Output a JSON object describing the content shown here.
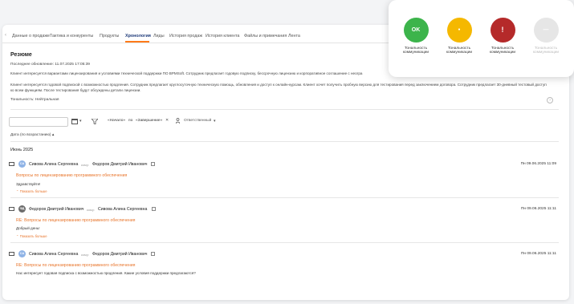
{
  "tabs": [
    "Данные о продаже",
    "Тактика и конкуренты",
    "Продукты",
    "Хронология",
    "Лиды",
    "История продаж",
    "История клиента",
    "Файлы и примечания",
    "Лента"
  ],
  "active_tab": "Хронология",
  "summary": {
    "title": "Резюме",
    "updated": "Последнее обновление: 11.07.2025 17:05:39",
    "para1": "Клиент интересуется вариантами лицензирования и условиями технической поддержки ПО BPMSoft. Сотрудник предлагает годовую подписку, бессрочную лицензию и корпоративное соглашение с неогра",
    "para2": "Клиент интересуется годовой подпиской с возможностью продления. Сотрудник предлагает круглосуточную техническую помощь, обновления и доступ к онлайн-курсам. Клиент хочет получить пробную версию для тестирования перед заключением договора. Сотрудник предлагает 30-дневный тестовый доступ ко всем функциям. После тестирования будут обсуждены детали лицензии.",
    "tone": "Тональность: Нейтральная"
  },
  "filters": {
    "start": "«Начало»",
    "by": "по",
    "end": "«Завершение»",
    "clear": "✕",
    "owner": "Ответственный"
  },
  "sort_label": "Дата (по возрастанию)",
  "sort_arrow": "▴",
  "month": "Июнь 2025",
  "entries": [
    {
      "initials": "СА",
      "from": "Сивова Алина Сергеевна",
      "to_label": "кому:",
      "to": "Федоров Дмитрий Иванович",
      "date": "Пн 09.06.2025 11:09",
      "subject": "Вопросы по лицензированию программного обеспечения",
      "body": "Здравствуйте!",
      "more": "Показать больше"
    },
    {
      "initials": "ФД",
      "from": "Федоров Дмитрий Иванович",
      "to_label": "кому:",
      "to": "Сивова Алина Сергеевна",
      "date": "Пн 09.06.2025 11:11",
      "subject": "RE: Вопросы по лицензированию программного обеспечения",
      "body": "Добрый день!",
      "more": "Показать больше"
    },
    {
      "initials": "СА",
      "from": "Сивова Алина Сергеевна",
      "to_label": "кому:",
      "to": "Федоров Дмитрий Иванович",
      "date": "Пн 09.06.2025 11:11",
      "subject": "RE: Вопросы по лицензированию программного обеспечения",
      "body": "Нас интересует годовая подписка с возможностью продления. Какие условия поддержки предлагаются?",
      "more": ""
    }
  ],
  "tonality": [
    {
      "symbol": "OK",
      "label": "Тональность коммуникации",
      "color": "#3cb44b",
      "disabled": false
    },
    {
      "symbol": "●",
      "label": "Тональность коммуникации",
      "color": "#f5b800",
      "disabled": false
    },
    {
      "symbol": "!",
      "label": "Тональность коммуникации",
      "color": "#b52a2a",
      "disabled": false
    },
    {
      "symbol": "—",
      "label": "Тональность коммуникации",
      "color": "#e6e6e6",
      "disabled": true
    }
  ],
  "accent_color": "#e8742a"
}
